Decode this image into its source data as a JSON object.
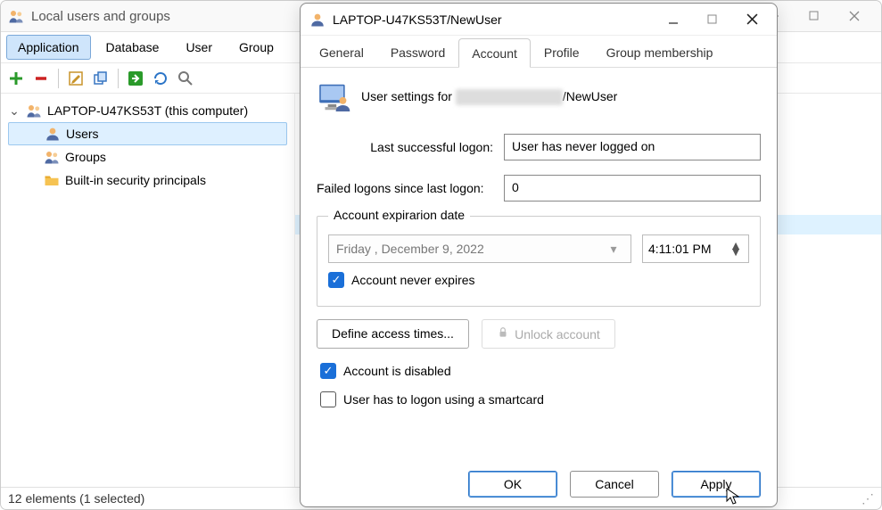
{
  "parent": {
    "title": "Local users and groups",
    "menu": {
      "application": "Application",
      "database": "Database",
      "user": "User",
      "group": "Group"
    },
    "toolbar": {
      "add": "add-icon",
      "remove": "remove-icon",
      "edit": "edit-icon",
      "clone": "clone-icon",
      "go": "go-icon",
      "refresh": "refresh-icon",
      "search": "search-icon"
    },
    "tree": {
      "root": "LAPTOP-U47KS53T (this computer)",
      "users": "Users",
      "groups": "Groups",
      "builtin": "Built-in security principals"
    },
    "status": "12 elements  (1 selected)"
  },
  "dialog": {
    "title": "LAPTOP-U47KS53T/NewUser",
    "tabs": {
      "general": "General",
      "password": "Password",
      "account": "Account",
      "profile": "Profile",
      "groupmember": "Group membership"
    },
    "user_settings_prefix": "User settings for ",
    "user_settings_suffix": "/NewUser",
    "last_logon_label": "Last successful logon:",
    "last_logon_value": "User has never logged on",
    "failed_label": "Failed logons since last logon:",
    "failed_value": "0",
    "expiration_legend": "Account expirarion date",
    "expiration_date": "Friday    ,  December   9, 2022",
    "expiration_time": "4:11:01 PM",
    "never_expires": "Account never expires",
    "define_times": "Define access times...",
    "unlock": "Unlock account",
    "disabled": "Account is disabled",
    "smartcard": "User has to logon using a smartcard",
    "ok": "OK",
    "cancel": "Cancel",
    "apply": "Apply"
  }
}
